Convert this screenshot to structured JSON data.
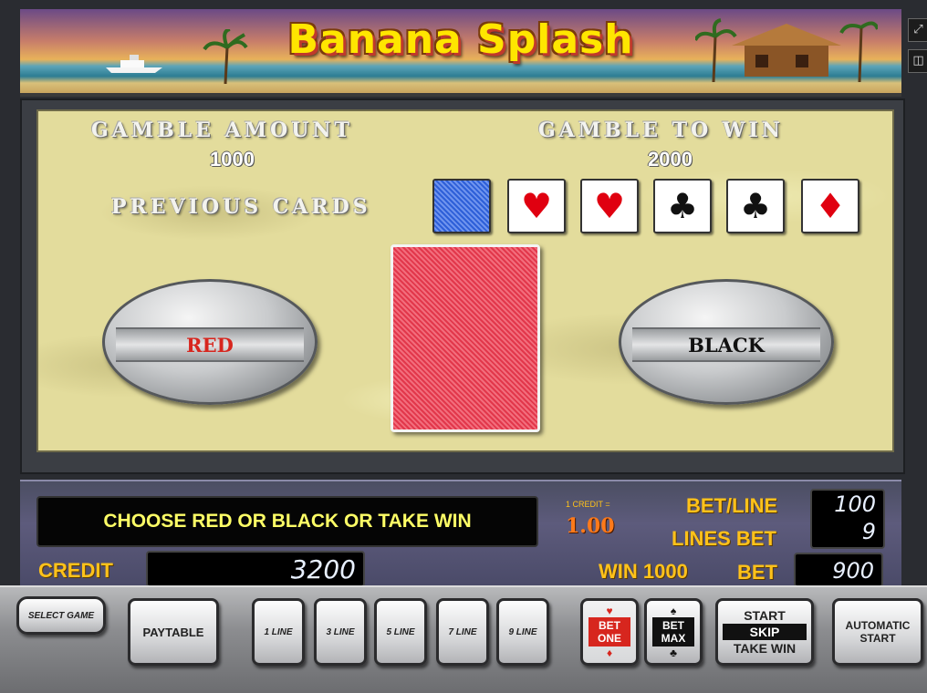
{
  "game": {
    "title": "Banana Splash"
  },
  "gamble": {
    "amount_label": "GAMBLE AMOUNT",
    "amount_value": "1000",
    "to_win_label": "GAMBLE TO WIN",
    "to_win_value": "2000",
    "previous_cards_label": "PREVIOUS CARDS",
    "previous_cards": [
      {
        "type": "back-blue",
        "symbol": ""
      },
      {
        "type": "red",
        "symbol": "♥"
      },
      {
        "type": "red",
        "symbol": "♥"
      },
      {
        "type": "black",
        "symbol": "♣"
      },
      {
        "type": "black",
        "symbol": "♣"
      },
      {
        "type": "red",
        "symbol": "♦"
      }
    ],
    "red_label": "RED",
    "black_label": "BLACK"
  },
  "info": {
    "message": "CHOOSE RED OR BLACK OR TAKE WIN",
    "credit_note": "1 CREDIT =",
    "credit_rate": "1.00",
    "bet_line_label": "BET/LINE",
    "bet_line_value": "100",
    "lines_bet_label": "LINES BET",
    "lines_bet_value": "9",
    "credit_label": "CREDIT",
    "credit_value": "3200",
    "win_label": "WIN 1000",
    "bet_label": "BET",
    "bet_value": "900"
  },
  "buttons": {
    "select_game": "SELECT GAME",
    "paytable": "PAYTABLE",
    "lines": [
      "1 LINE",
      "3 LINE",
      "5 LINE",
      "7 LINE",
      "9 LINE"
    ],
    "bet_one": "BET ONE",
    "bet_max": "BET MAX",
    "start": "START",
    "skip": "SKIP",
    "take_win": "TAKE WIN",
    "automatic_start": "AUTOMATIC START"
  },
  "colors": {
    "sand": "#e3dc9c",
    "title_yellow": "#ffe600",
    "label_gold": "#ffc21a",
    "message_yellow": "#ffff66",
    "card_red": "#e2374b",
    "card_blue": "#2d5fd8"
  },
  "icons": {
    "expand": "expand-icon",
    "camera": "camera-icon"
  }
}
